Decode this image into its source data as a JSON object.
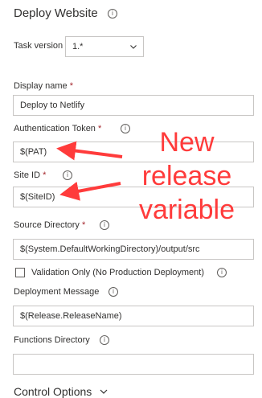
{
  "header": {
    "title": "Deploy Website"
  },
  "task_version": {
    "label": "Task version",
    "value": "1.*"
  },
  "display_name": {
    "label": "Display name",
    "required": "*",
    "value": "Deploy to Netlify"
  },
  "auth_token": {
    "label": "Authentication Token",
    "required": "*",
    "value": "$(PAT)"
  },
  "site_id": {
    "label": "Site ID",
    "required": "*",
    "value": "$(SiteID)"
  },
  "source_directory": {
    "label": "Source Directory",
    "required": "*",
    "value": "$(System.DefaultWorkingDirectory)/output/src"
  },
  "validation": {
    "label": "Validation Only (No Production Deployment)"
  },
  "deployment_message": {
    "label": "Deployment Message",
    "value": "$(Release.ReleaseName)"
  },
  "functions_directory": {
    "label": "Functions Directory",
    "value": ""
  },
  "control_options": {
    "label": "Control Options"
  },
  "annotation": {
    "line1": "New",
    "line2": "release",
    "line3": "variable"
  },
  "icons": {
    "info": "info-icon",
    "chevron": "chevron-down-icon"
  },
  "colors": {
    "annotation": "#ff3b3b",
    "required": "#a4262c",
    "border": "#c8c6c4"
  }
}
